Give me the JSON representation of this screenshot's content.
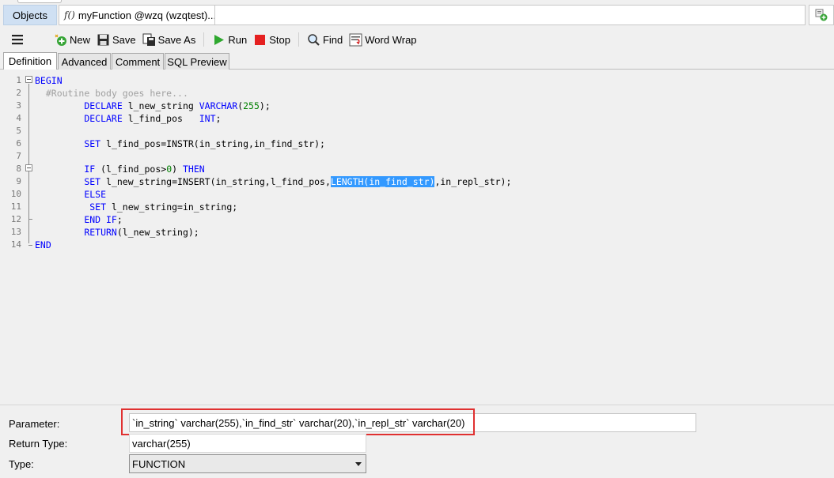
{
  "tabs": {
    "objects_label": "Objects",
    "doc_label": "myFunction @wzq (wzqtest)...",
    "doc_icon": "function-icon"
  },
  "toolbar": {
    "new_label": "New",
    "save_label": "Save",
    "save_as_label": "Save As",
    "run_label": "Run",
    "stop_label": "Stop",
    "find_label": "Find",
    "word_wrap_label": "Word Wrap"
  },
  "subtabs": [
    {
      "label": "Definition",
      "active": true
    },
    {
      "label": "Advanced",
      "active": false
    },
    {
      "label": "Comment",
      "active": false
    },
    {
      "label": "SQL Preview",
      "active": false
    }
  ],
  "editor": {
    "line_numbers": [
      "1",
      "2",
      "3",
      "4",
      "5",
      "6",
      "7",
      "8",
      "9",
      "10",
      "11",
      "12",
      "13",
      "14"
    ],
    "lines": [
      [
        {
          "t": "BEGIN",
          "c": "kw"
        }
      ],
      [
        {
          "t": "  "
        },
        {
          "t": "#Routine body goes here...",
          "c": "cm"
        }
      ],
      [
        {
          "t": "         "
        },
        {
          "t": "DECLARE",
          "c": "kw"
        },
        {
          "t": " l_new_string "
        },
        {
          "t": "VARCHAR",
          "c": "kw"
        },
        {
          "t": "("
        },
        {
          "t": "255",
          "c": "num"
        },
        {
          "t": ");"
        }
      ],
      [
        {
          "t": "         "
        },
        {
          "t": "DECLARE",
          "c": "kw"
        },
        {
          "t": " l_find_pos   "
        },
        {
          "t": "INT",
          "c": "kw"
        },
        {
          "t": ";"
        }
      ],
      [
        {
          "t": ""
        }
      ],
      [
        {
          "t": "         "
        },
        {
          "t": "SET",
          "c": "kw"
        },
        {
          "t": " l_find_pos=INSTR(in_string,in_find_str);"
        }
      ],
      [
        {
          "t": ""
        }
      ],
      [
        {
          "t": "         "
        },
        {
          "t": "IF",
          "c": "kw"
        },
        {
          "t": " (l_find_pos>"
        },
        {
          "t": "0",
          "c": "num"
        },
        {
          "t": ") "
        },
        {
          "t": "THEN",
          "c": "kw"
        }
      ],
      [
        {
          "t": "         "
        },
        {
          "t": "SET",
          "c": "kw"
        },
        {
          "t": " l_new_string=INSERT(in_string,l_find_pos,"
        },
        {
          "t": "LENGTH(in_find_str)",
          "c": "hl"
        },
        {
          "t": ",in_repl_str);"
        }
      ],
      [
        {
          "t": "         "
        },
        {
          "t": "ELSE",
          "c": "kw"
        }
      ],
      [
        {
          "t": "          "
        },
        {
          "t": "SET",
          "c": "kw"
        },
        {
          "t": " l_new_string=in_string;"
        }
      ],
      [
        {
          "t": "         "
        },
        {
          "t": "END IF",
          "c": "kw"
        },
        {
          "t": ";"
        }
      ],
      [
        {
          "t": "         "
        },
        {
          "t": "RETURN",
          "c": "kw"
        },
        {
          "t": "(l_new_string);"
        }
      ],
      [
        {
          "t": "END",
          "c": "kw"
        }
      ]
    ]
  },
  "properties": {
    "parameter_label": "Parameter:",
    "parameter_value": "`in_string` varchar(255),`in_find_str` varchar(20),`in_repl_str` varchar(20)",
    "return_type_label": "Return Type:",
    "return_type_value": "varchar(255)",
    "type_label": "Type:",
    "type_value": "FUNCTION"
  },
  "colors": {
    "keyword": "#0000ff",
    "comment": "#a0a0a0",
    "number": "#008000",
    "selection": "#3399ff",
    "highlight_box": "#e03030"
  }
}
